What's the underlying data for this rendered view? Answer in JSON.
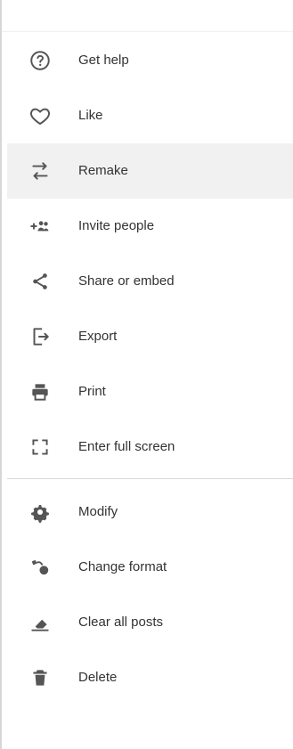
{
  "menu": {
    "sections": [
      {
        "items": [
          {
            "label": "Get help",
            "icon": "help-circle-icon"
          },
          {
            "label": "Like",
            "icon": "heart-outline-icon"
          },
          {
            "label": "Remake",
            "icon": "remake-icon",
            "active": true
          },
          {
            "label": "Invite people",
            "icon": "invite-people-icon"
          },
          {
            "label": "Share or embed",
            "icon": "share-icon"
          },
          {
            "label": "Export",
            "icon": "export-icon"
          },
          {
            "label": "Print",
            "icon": "print-icon"
          },
          {
            "label": "Enter full screen",
            "icon": "fullscreen-icon"
          }
        ]
      },
      {
        "items": [
          {
            "label": "Modify",
            "icon": "gear-icon"
          },
          {
            "label": "Change format",
            "icon": "change-format-icon"
          },
          {
            "label": "Clear all posts",
            "icon": "eraser-icon"
          },
          {
            "label": "Delete",
            "icon": "trash-icon"
          }
        ]
      }
    ]
  },
  "colors": {
    "text": "#333333",
    "icon": "#555555",
    "active_bg": "#f1f1f1",
    "divider": "#d9d9d9"
  }
}
